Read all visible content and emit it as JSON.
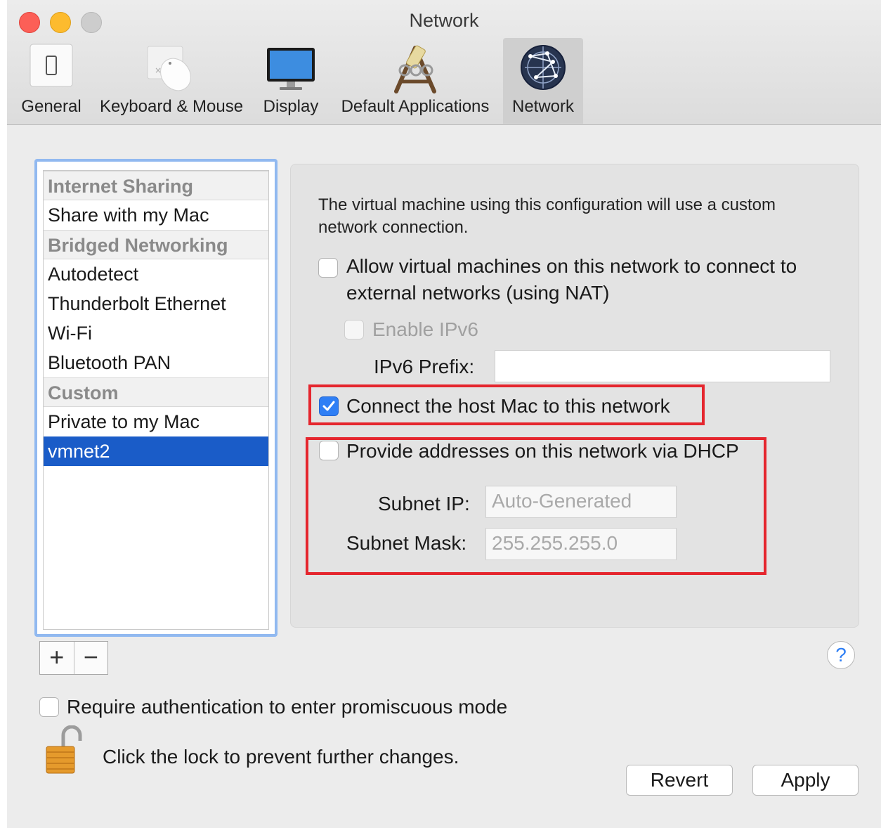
{
  "window": {
    "title": "Network"
  },
  "toolbar": {
    "items": [
      {
        "label": "General",
        "icon": "switch-icon"
      },
      {
        "label": "Keyboard & Mouse",
        "icon": "mouse-icon"
      },
      {
        "label": "Display",
        "icon": "display-icon"
      },
      {
        "label": "Default Applications",
        "icon": "applications-icon"
      },
      {
        "label": "Network",
        "icon": "globe-icon",
        "active": true
      }
    ]
  },
  "sidebar": {
    "groups": [
      {
        "header": "Internet Sharing",
        "items": [
          "Share with my Mac"
        ]
      },
      {
        "header": "Bridged Networking",
        "items": [
          "Autodetect",
          "Thunderbolt Ethernet",
          "Wi-Fi",
          "Bluetooth PAN"
        ]
      },
      {
        "header": "Custom",
        "items": [
          "Private to my Mac",
          "vmnet2"
        ]
      }
    ],
    "selected": "vmnet2",
    "add_label": "+",
    "remove_label": "−"
  },
  "panel": {
    "description": "The virtual machine using this configuration will use a custom network connection.",
    "nat": {
      "label": "Allow virtual machines on this network to connect to external networks (using NAT)",
      "checked": false
    },
    "ipv6": {
      "label": "Enable IPv6",
      "checked": false,
      "disabled": true
    },
    "ipv6_prefix": {
      "label": "IPv6 Prefix:",
      "value": ""
    },
    "connect_host": {
      "label": "Connect the host Mac to this network",
      "checked": true
    },
    "dhcp": {
      "label": "Provide addresses on this network via DHCP",
      "checked": false
    },
    "subnet_ip": {
      "label": "Subnet IP:",
      "placeholder": "Auto-Generated"
    },
    "subnet_mask": {
      "label": "Subnet Mask:",
      "placeholder": "255.255.255.0"
    }
  },
  "footer": {
    "help_label": "?",
    "promiscuous": {
      "label": "Require authentication to enter promiscuous mode",
      "checked": false
    },
    "lock_text": "Click the lock to prevent further changes.",
    "revert_label": "Revert",
    "apply_label": "Apply"
  },
  "colors": {
    "accent": "#2f7ff5",
    "selection": "#1a5cc8",
    "highlight_box": "#e5262e"
  }
}
